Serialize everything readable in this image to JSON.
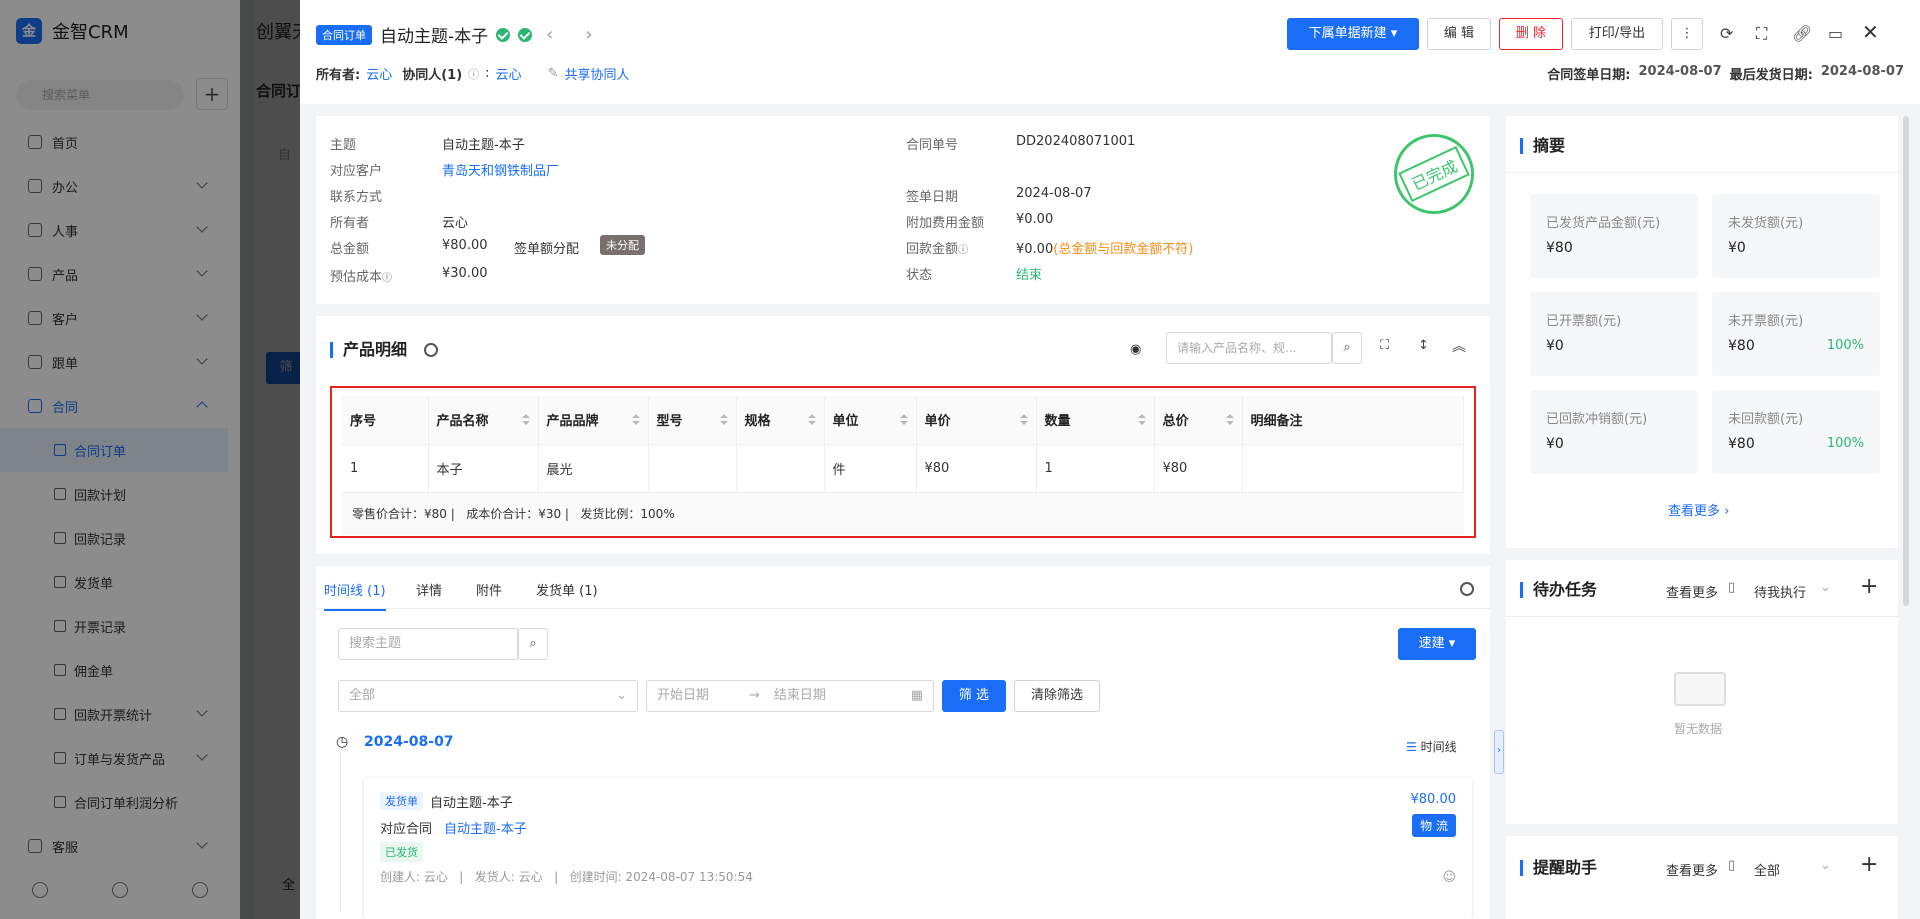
{
  "app": {
    "name": "金智CRM",
    "logo_mark": "金",
    "search_placeholder": "搜索菜单",
    "bg_tab_title": "创翼天",
    "bg_sub_title": "合同订",
    "bg_filter_label": "筛",
    "bg_fragment_1": "自",
    "bg_fragment_2": "全"
  },
  "nav": {
    "home": "首页",
    "office": "办公",
    "hr": "人事",
    "product": "产品",
    "customer": "客户",
    "followup": "跟单",
    "contract": "合同",
    "contract_order": "合同订单",
    "payment_plan": "回款计划",
    "payment_record": "回款记录",
    "delivery": "发货单",
    "invoice": "开票记录",
    "commission": "佣金单",
    "pay_invoice_stat": "回款开票统计",
    "order_product": "订单与发货产品",
    "profit": "合同订单利润分析",
    "service": "客服"
  },
  "header": {
    "type_tag": "合同订单",
    "title": "自动主题-本子",
    "owner_label": "所有者:",
    "owner": "云心",
    "collab_label": "协同人(1)",
    "collab_sep": ":",
    "collab": "云心",
    "share_label": "共享协同人",
    "sign_date_label": "合同签单日期:",
    "sign_date": "2024-08-07",
    "last_ship_label": "最后发货日期:",
    "last_ship": "2024-08-07",
    "btn_sub_new": "下属单据新建",
    "btn_edit": "编 辑",
    "btn_delete": "删 除",
    "btn_print": "打印/导出"
  },
  "info": {
    "subject_label": "主题",
    "subject": "自动主题-本子",
    "customer_label": "对应客户",
    "customer": "青岛天和钢铁制品厂",
    "contact_label": "联系方式",
    "owner_label": "所有者",
    "owner": "云心",
    "total_label": "总金额",
    "total": "¥80.00",
    "split_label": "签单额分配",
    "split_badge": "未分配",
    "cost_label": "预估成本",
    "cost": "¥30.00",
    "no_label": "合同单号",
    "no": "DD202408071001",
    "date_label": "签单日期",
    "date": "2024-08-07",
    "extra_label": "附加费用金额",
    "extra": "¥0.00",
    "paid_label": "回款金额",
    "paid": "¥0.00",
    "paid_warn": "(总金额与回款金额不符)",
    "status_label": "状态",
    "status": "结束",
    "stamp": "已完成"
  },
  "products": {
    "title": "产品明细",
    "search_placeholder": "请输入产品名称、规...",
    "columns": [
      "序号",
      "产品名称",
      "产品品牌",
      "型号",
      "规格",
      "单位",
      "单价",
      "数量",
      "总价",
      "明细备注"
    ],
    "rows": [
      [
        "1",
        "本子",
        "晨光",
        "",
        "",
        "件",
        "¥80",
        "1",
        "¥80",
        ""
      ]
    ],
    "summary": "零售价合计：¥80 |   成本价合计：¥30 |   发货比例：100%"
  },
  "timeline": {
    "tabs": [
      "时间线 (1)",
      "详情",
      "附件",
      "发货单 (1)"
    ],
    "search_placeholder": "搜索主题",
    "quick_btn": "速建",
    "filter_all": "全部",
    "start_date": "开始日期",
    "end_date": "结束日期",
    "filter_btn": "筛 选",
    "clear_btn": "清除筛选",
    "date": "2024-08-07",
    "view_label": "时间线",
    "item": {
      "tag": "发货单",
      "title": "自动主题-本子",
      "amount": "¥80.00",
      "contract_label": "对应合同",
      "contract": "自动主题-本子",
      "logistics_btn": "物 流",
      "status": "已发货",
      "meta": "创建人: 云心   |   发货人: 云心   |   创建时间: 2024-08-07 13:50:54"
    }
  },
  "summary": {
    "title": "摘要",
    "boxes": [
      {
        "k": "已发货产品金额(元)",
        "v": "¥80",
        "p": ""
      },
      {
        "k": "未发货额(元)",
        "v": "¥0",
        "p": ""
      },
      {
        "k": "已开票额(元)",
        "v": "¥0",
        "p": ""
      },
      {
        "k": "未开票额(元)",
        "v": "¥80",
        "p": "100%"
      },
      {
        "k": "已回款冲销额(元)",
        "v": "¥0",
        "p": ""
      },
      {
        "k": "未回款额(元)",
        "v": "¥80",
        "p": "100%"
      }
    ],
    "more": "查看更多"
  },
  "todo": {
    "title": "待办任务",
    "more": "查看更多",
    "filter": "待我执行",
    "empty": "暂无数据"
  },
  "remind": {
    "title": "提醒助手",
    "more": "查看更多",
    "filter": "全部"
  },
  "colors": {
    "accent": "#1a6ef5",
    "success": "#2bb673",
    "danger": "#f5222d",
    "warn": "#fa8c16"
  }
}
